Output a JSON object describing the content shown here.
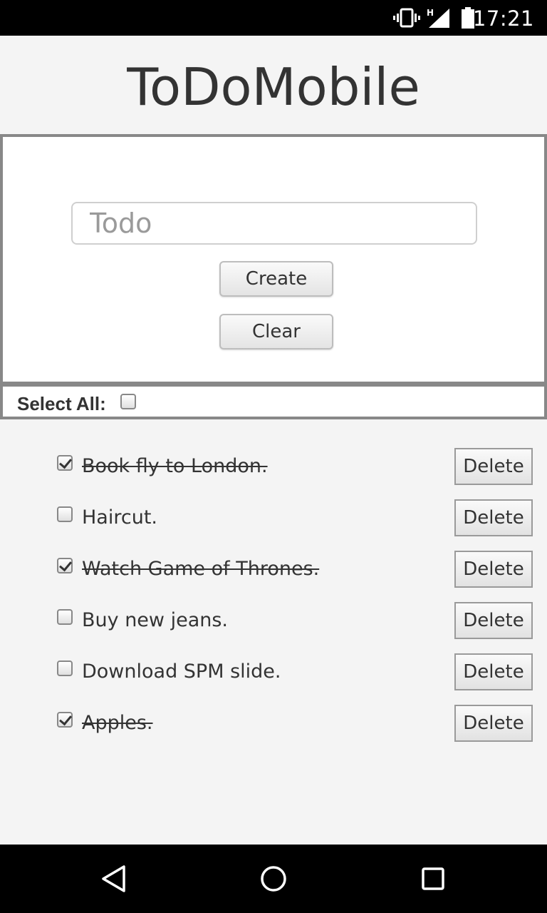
{
  "status_bar": {
    "time": "17:21",
    "icons": [
      "vibrate-icon",
      "signal-h-icon",
      "battery-icon"
    ]
  },
  "app": {
    "title": "ToDoMobile"
  },
  "form": {
    "input_value": "",
    "input_placeholder": "Todo",
    "create_label": "Create",
    "clear_label": "Clear"
  },
  "select_all": {
    "label": "Select All:",
    "checked": false
  },
  "todos": [
    {
      "text": "Book fly to London.",
      "done": true,
      "delete_label": "Delete"
    },
    {
      "text": "Haircut.",
      "done": false,
      "delete_label": "Delete"
    },
    {
      "text": "Watch Game of Thrones.",
      "done": true,
      "delete_label": "Delete"
    },
    {
      "text": "Buy new jeans.",
      "done": false,
      "delete_label": "Delete"
    },
    {
      "text": "Download SPM slide.",
      "done": false,
      "delete_label": "Delete"
    },
    {
      "text": "Apples.",
      "done": true,
      "delete_label": "Delete"
    }
  ],
  "nav_bar": {
    "icons": [
      "back-icon",
      "home-icon",
      "recents-icon"
    ]
  }
}
